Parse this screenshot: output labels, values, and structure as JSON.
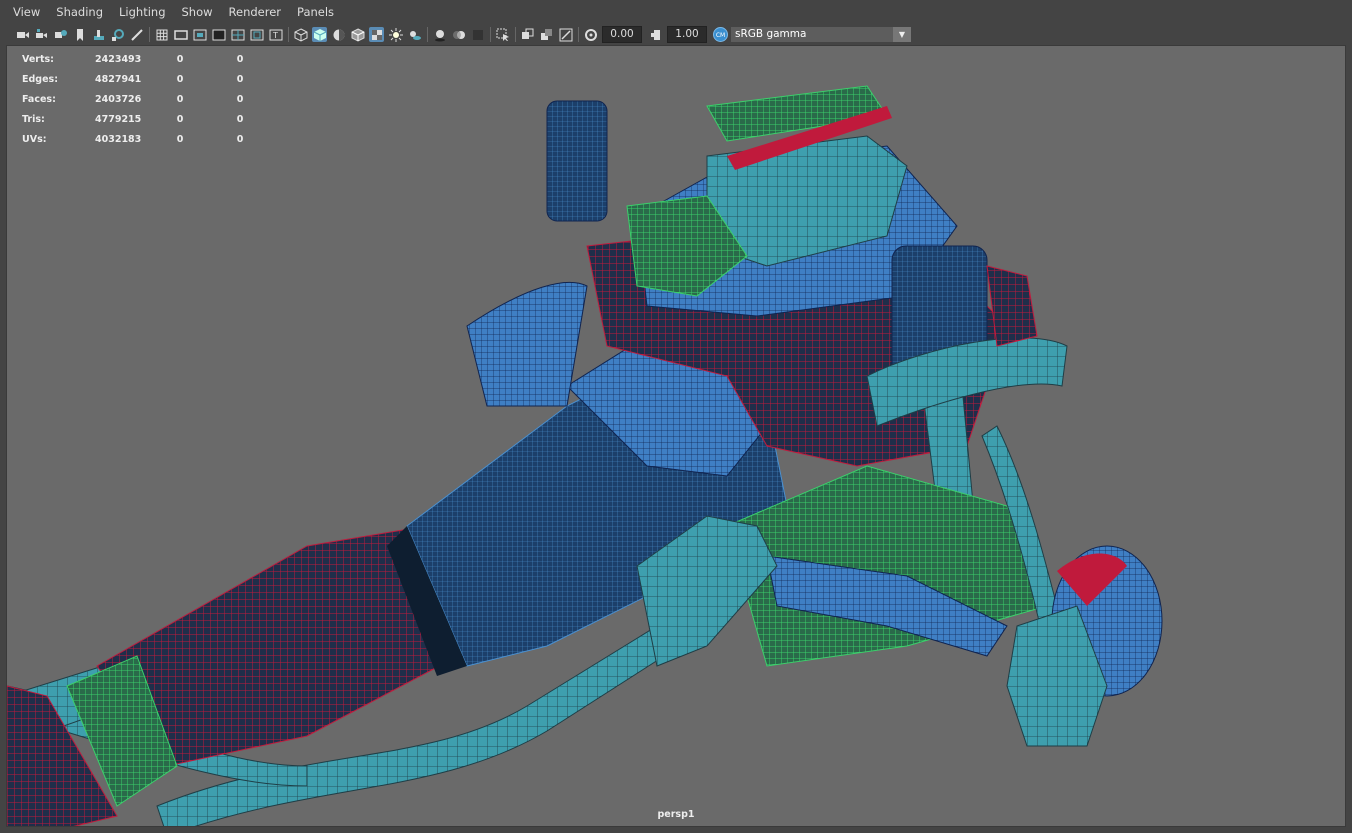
{
  "menu": [
    "View",
    "Shading",
    "Lighting",
    "Show",
    "Renderer",
    "Panels"
  ],
  "toolbar": {
    "exposure": "0.00",
    "gamma": "1.00",
    "color_space": "sRGB gamma",
    "color_management_icon_text": "CM"
  },
  "hud": {
    "rows": [
      {
        "label": "Verts:",
        "value": "2423493",
        "c1": "0",
        "c2": "0"
      },
      {
        "label": "Edges:",
        "value": "4827941",
        "c1": "0",
        "c2": "0"
      },
      {
        "label": "Faces:",
        "value": "2403726",
        "c1": "0",
        "c2": "0"
      },
      {
        "label": "Tris:",
        "value": "4779215",
        "c1": "0",
        "c2": "0"
      },
      {
        "label": "UVs:",
        "value": "4032183",
        "c1": "0",
        "c2": "0"
      }
    ]
  },
  "camera_name": "persp1",
  "colors": {
    "background": "#6a6a6a",
    "teal": "#3e9fae",
    "blue": "#3f7fc4",
    "red": "#c01a3c",
    "green": "#3bd06b"
  }
}
